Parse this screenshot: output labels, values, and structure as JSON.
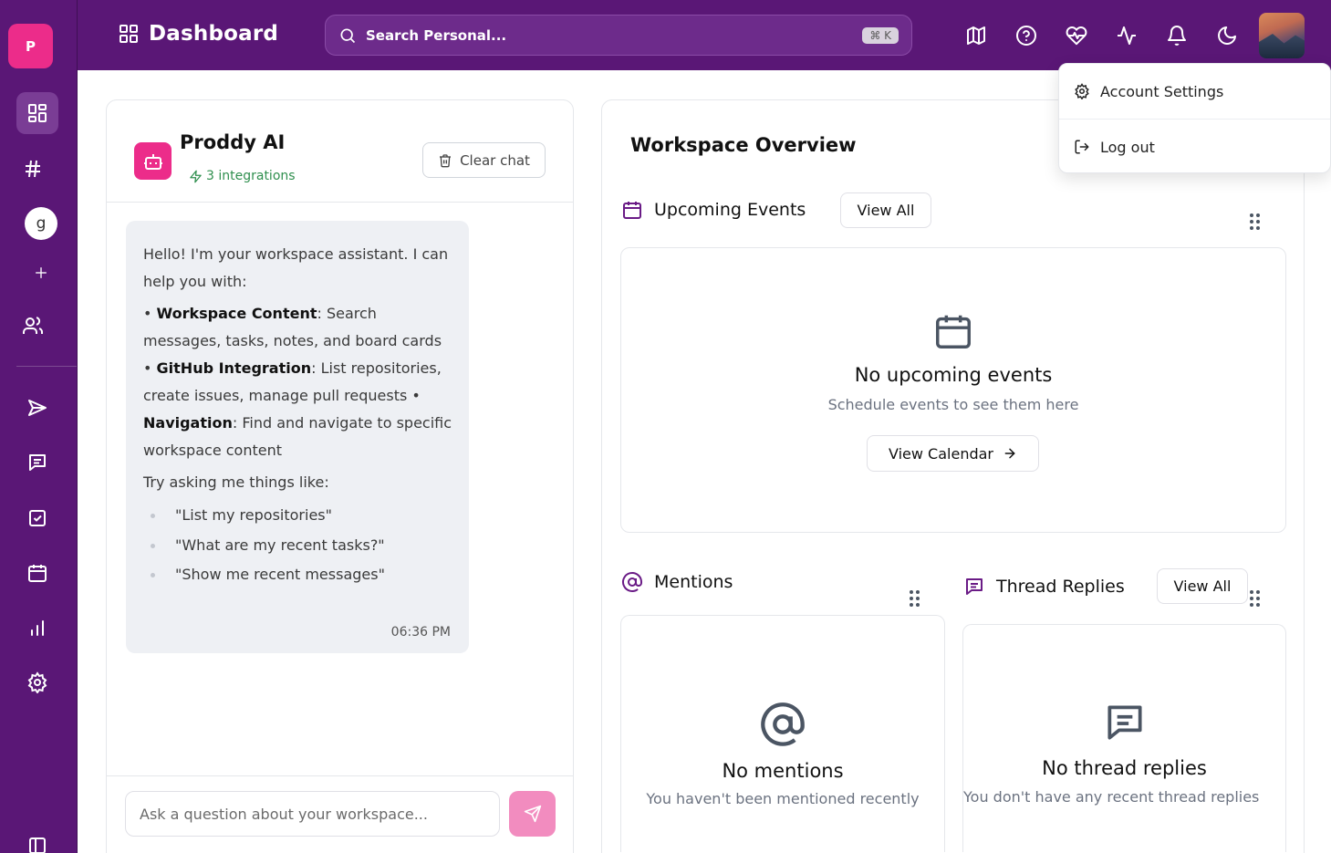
{
  "workspace": {
    "initial": "P"
  },
  "header": {
    "title": "Dashboard",
    "search_placeholder": "Search Personal...",
    "shortcut": "⌘ K",
    "icons": [
      "map-icon",
      "help-icon",
      "heart-pulse-icon",
      "activity-icon",
      "bell-icon",
      "moon-icon"
    ]
  },
  "rail": {
    "user_initial": "g",
    "items": [
      "dashboard-icon",
      "hash-icon",
      "user-avatar",
      "plus-icon",
      "users-icon",
      "send-icon",
      "chat-icon",
      "tasks-icon",
      "calendar-icon",
      "analytics-icon",
      "settings-icon",
      "sidebar-toggle-icon"
    ]
  },
  "ai": {
    "title": "Proddy AI",
    "integrations": "3 integrations",
    "clear_label": "Clear chat",
    "message": {
      "intro": "Hello! I'm your workspace assistant. I can help you with:",
      "b1_label": "Workspace Content",
      "b1_text": ": Search messages, tasks, notes, and board cards",
      "b2_label": "GitHub Integration",
      "b2_text": ": List repositories, create issues, manage pull requests",
      "b3_label": "Navigation",
      "b3_text": ": Find and navigate to specific workspace content",
      "try_label": "Try asking me things like:",
      "examples": [
        "\"List my repositories\"",
        "\"What are my recent tasks?\"",
        "\"Show me recent messages\""
      ],
      "time": "06:36 PM"
    },
    "input_placeholder": "Ask a question about your workspace..."
  },
  "overview": {
    "title": "Workspace Overview",
    "events": {
      "title": "Upcoming Events",
      "view_all": "View All",
      "empty_title": "No upcoming events",
      "empty_sub": "Schedule events to see them here",
      "calendar_button": "View Calendar"
    },
    "mentions": {
      "title": "Mentions",
      "empty_title": "No mentions",
      "empty_sub": "You haven't been mentioned recently"
    },
    "threads": {
      "title": "Thread Replies",
      "view_all": "View All",
      "empty_title": "No thread replies",
      "empty_sub": "You don't have any recent thread replies"
    }
  },
  "account_menu": {
    "settings_label": "Account Settings",
    "logout_label": "Log out"
  },
  "colors": {
    "brand_purple": "#5a1776",
    "accent_pink": "#ec2c8a",
    "integration_green": "#2f8f4e"
  }
}
